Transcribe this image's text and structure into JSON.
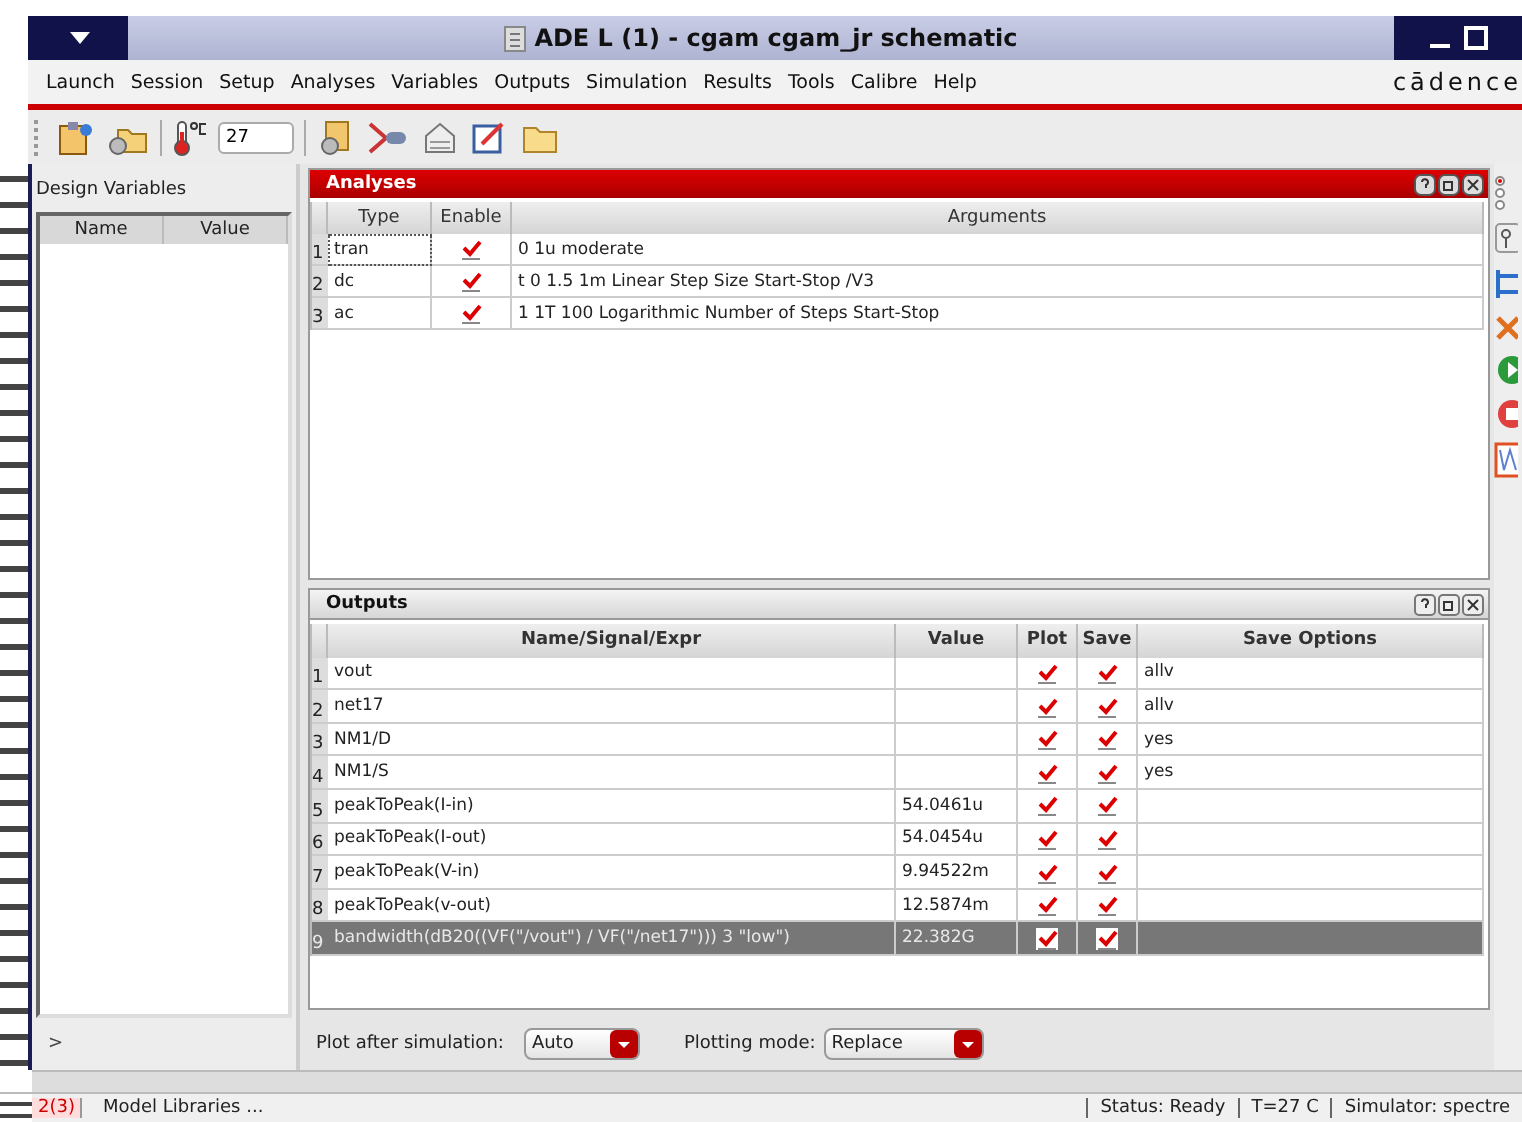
{
  "window": {
    "title": "ADE L (1) - cgam cgam_jr schematic"
  },
  "menu": [
    "Launch",
    "Session",
    "Setup",
    "Analyses",
    "Variables",
    "Outputs",
    "Simulation",
    "Results",
    "Tools",
    "Calibre",
    "Help"
  ],
  "brand": "cādence",
  "toolbar": {
    "temperature": "27"
  },
  "design_variables": {
    "title": "Design Variables",
    "columns": [
      "Name",
      "Value"
    ],
    "prompt": ">"
  },
  "analyses": {
    "title": "Analyses",
    "columns": [
      "Type",
      "Enable",
      "Arguments"
    ],
    "rows": [
      {
        "index": "1",
        "type": "tran",
        "enabled": true,
        "arguments": "0 1u moderate",
        "focused": true
      },
      {
        "index": "2",
        "type": "dc",
        "enabled": true,
        "arguments": "t 0 1.5 1m Linear Step Size Start-Stop /V3",
        "focused": false
      },
      {
        "index": "3",
        "type": "ac",
        "enabled": true,
        "arguments": "1 1T 100 Logarithmic Number of Steps Start-Stop",
        "focused": false
      }
    ]
  },
  "outputs": {
    "title": "Outputs",
    "columns": [
      "Name/Signal/Expr",
      "Value",
      "Plot",
      "Save",
      "Save Options"
    ],
    "rows": [
      {
        "index": "1",
        "name": "vout",
        "value": "",
        "plot": true,
        "save": true,
        "save_options": "allv",
        "selected": false
      },
      {
        "index": "2",
        "name": "net17",
        "value": "",
        "plot": true,
        "save": true,
        "save_options": "allv",
        "selected": false
      },
      {
        "index": "3",
        "name": "NM1/D",
        "value": "",
        "plot": true,
        "save": true,
        "save_options": "yes",
        "selected": false
      },
      {
        "index": "4",
        "name": "NM1/S",
        "value": "",
        "plot": true,
        "save": true,
        "save_options": "yes",
        "selected": false
      },
      {
        "index": "5",
        "name": "peakToPeak(I-in)",
        "value": "54.0461u",
        "plot": true,
        "save": true,
        "save_options": "",
        "selected": false
      },
      {
        "index": "6",
        "name": "peakToPeak(I-out)",
        "value": "54.0454u",
        "plot": true,
        "save": true,
        "save_options": "",
        "selected": false
      },
      {
        "index": "7",
        "name": "peakToPeak(V-in)",
        "value": "9.94522m",
        "plot": true,
        "save": true,
        "save_options": "",
        "selected": false
      },
      {
        "index": "8",
        "name": "peakToPeak(v-out)",
        "value": "12.5874m",
        "plot": true,
        "save": true,
        "save_options": "",
        "selected": false
      },
      {
        "index": "9",
        "name": "bandwidth(dB20((VF(\"/vout\") / VF(\"/net17\"))) 3 \"low\")",
        "value": "22.382G",
        "plot": true,
        "save": true,
        "save_options": "",
        "selected": true
      }
    ]
  },
  "plot_after_simulation": {
    "label": "Plot after simulation:",
    "value": "Auto"
  },
  "plotting_mode": {
    "label": "Plotting mode:",
    "value": "Replace"
  },
  "status_bar": {
    "page": "2(3)",
    "message": "Model Libraries ...",
    "status": "Status: Ready",
    "temperature": "T=27  C",
    "simulator": "Simulator: spectre"
  }
}
